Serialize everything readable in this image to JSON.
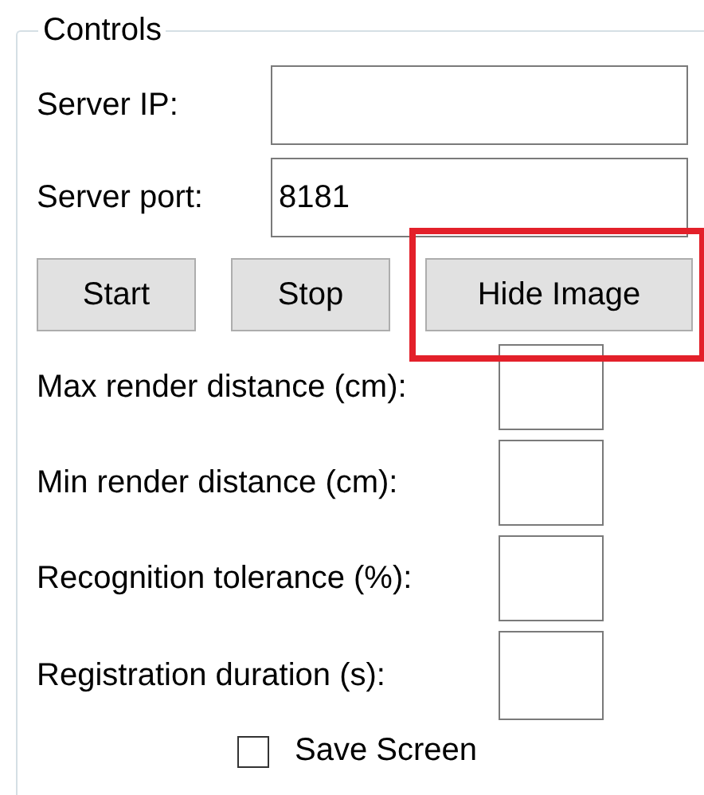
{
  "group": {
    "title": "Controls"
  },
  "server_fields": [
    {
      "label": "Server IP:"
    },
    {
      "label": "Server port:",
      "value": "8181"
    }
  ],
  "buttons": [
    {
      "label": "Start",
      "highlighted": false
    },
    {
      "label": "Stop",
      "highlighted": false
    },
    {
      "label": "Hide Image",
      "highlighted": true
    }
  ],
  "settings": [
    {
      "label": "Max render distance (cm):"
    },
    {
      "label": "Min render distance (cm):"
    },
    {
      "label": "Recognition tolerance (%):"
    },
    {
      "label": "Registration duration (s):"
    }
  ],
  "save_screen": {
    "label": "Save Screen",
    "checked": false
  }
}
